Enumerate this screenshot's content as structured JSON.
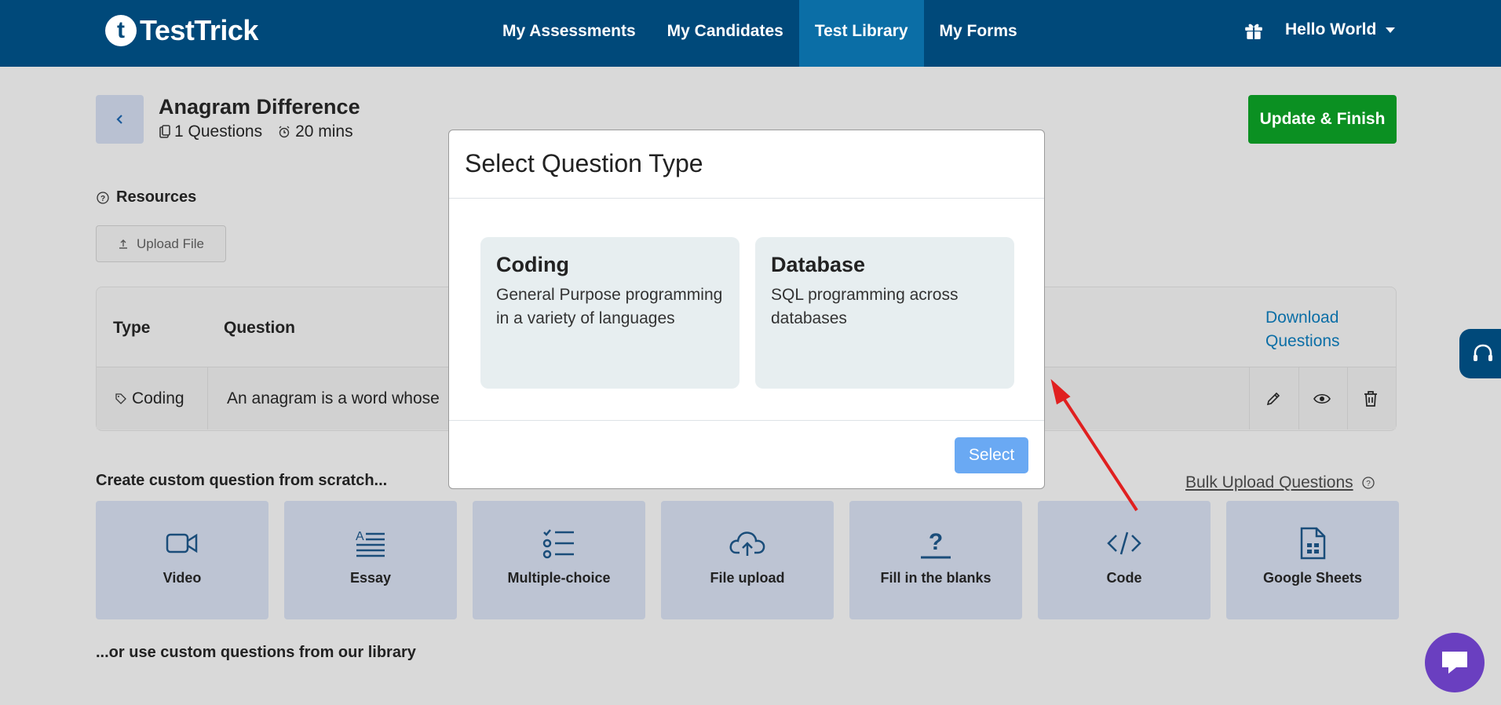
{
  "header": {
    "logo_letter": "t",
    "logo_text": "TestTrick",
    "nav": [
      {
        "label": "My Assessments"
      },
      {
        "label": "My Candidates"
      },
      {
        "label": "Test Library"
      },
      {
        "label": "My Forms"
      }
    ],
    "user_label": "Hello World"
  },
  "test": {
    "title": "Anagram Difference",
    "questions": "1 Questions",
    "duration": "20 mins",
    "update_label": "Update & Finish"
  },
  "resources": {
    "title": "Resources",
    "upload_label": "Upload File"
  },
  "table": {
    "col_type": "Type",
    "col_question": "Question",
    "download_line1": "Download",
    "download_line2": "Questions",
    "row": {
      "type": "Coding",
      "question": "An anagram is a word whose"
    }
  },
  "custom": {
    "title": "Create custom question from scratch...",
    "bulk_label": "Bulk Upload Questions",
    "cards": [
      {
        "label": "Video",
        "icon": "video-icon"
      },
      {
        "label": "Essay",
        "icon": "essay-icon"
      },
      {
        "label": "Multiple-choice",
        "icon": "multiple-choice-icon"
      },
      {
        "label": "File upload",
        "icon": "cloud-upload-icon"
      },
      {
        "label": "Fill in the blanks",
        "icon": "fill-blank-icon"
      },
      {
        "label": "Code",
        "icon": "code-icon"
      },
      {
        "label": "Google Sheets",
        "icon": "sheet-icon"
      }
    ],
    "library_title": "...or use custom questions from our library"
  },
  "modal": {
    "title": "Select Question Type",
    "options": [
      {
        "name": "Coding",
        "desc": "General Purpose programming in a variety of languages"
      },
      {
        "name": "Database",
        "desc": "SQL programming across databases"
      }
    ],
    "select_label": "Select"
  },
  "colors": {
    "header": "#00497a",
    "active_nav": "#0b6ea6",
    "update_button": "#0b9022",
    "select_button": "#6aa9f3",
    "arrow": "#e02020"
  }
}
